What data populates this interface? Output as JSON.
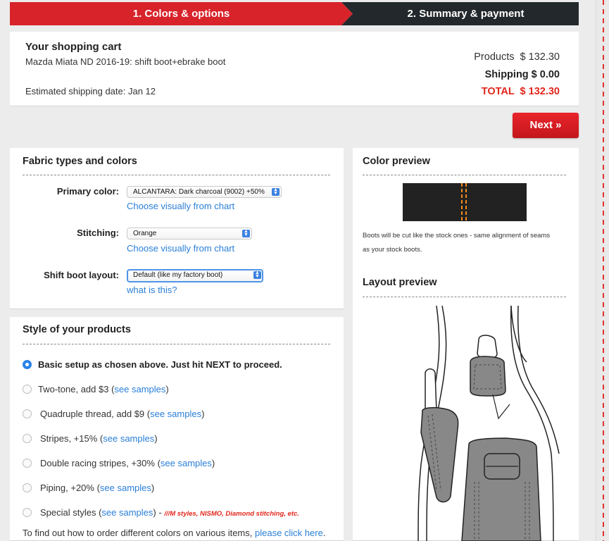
{
  "steps": {
    "step1": "1. Colors & options",
    "step2": "2. Summary & payment"
  },
  "colors": {
    "accent_red": "#e1261c",
    "step_active": "#d8232a",
    "step_inactive": "#23282c",
    "link_blue": "#2a7fd8",
    "radio_blue": "#2a82e8"
  },
  "cart": {
    "title": "Your shopping cart",
    "item": "Mazda Miata ND 2016-19: shift boot+ebrake boot",
    "shipping_date": "Estimated shipping date: Jan 12",
    "products": "Products  $ 132.30",
    "shipping": "Shipping $ 0.00",
    "total": "TOTAL  $ 132.30"
  },
  "next_label": "Next »",
  "fabric": {
    "title": "Fabric types and colors",
    "primary_label": "Primary color:",
    "primary_value": "ALCANTARA: Dark charcoal (9002) +50%",
    "primary_link": "Choose visually from chart",
    "stitching_label": "Stitching:",
    "stitching_value": "Orange",
    "stitching_link": "Choose visually from chart",
    "layout_label": "Shift boot layout:",
    "layout_value": "Default (like my factory boot)",
    "layout_link": "what is this?"
  },
  "style": {
    "title": "Style of your products",
    "options": [
      {
        "text": "Basic setup as chosen above. Just hit NEXT to proceed.",
        "selected": true
      },
      {
        "text": "Two-tone, add $3 (",
        "link": "see samples",
        "after": ")"
      },
      {
        "text": "Quadruple thread, add $9 (",
        "link": "see samples",
        "after": ")"
      },
      {
        "text": "Stripes, +15% (",
        "link": "see samples",
        "after": ")"
      },
      {
        "text": "Double racing stripes, +30% (",
        "link": "see samples",
        "after": ")"
      },
      {
        "text": "Piping, +20% (",
        "link": "see samples",
        "after": ")"
      },
      {
        "text": "Special styles (",
        "link": "see samples",
        "after": ") - ",
        "note": "///M styles, NISMO, Diamond stitching, etc."
      }
    ],
    "footer_text": "To find out how to order different colors on various items, ",
    "footer_link": "please click here",
    "footer_after": "."
  },
  "preview": {
    "color_title": "Color preview",
    "note_line1": "Boots will be cut like the stock ones - same alignment of seams",
    "note_line2": "as your stock boots.",
    "layout_title": "Layout preview",
    "swatch_color": "#222222",
    "stitch_color": "#f28a1c"
  }
}
